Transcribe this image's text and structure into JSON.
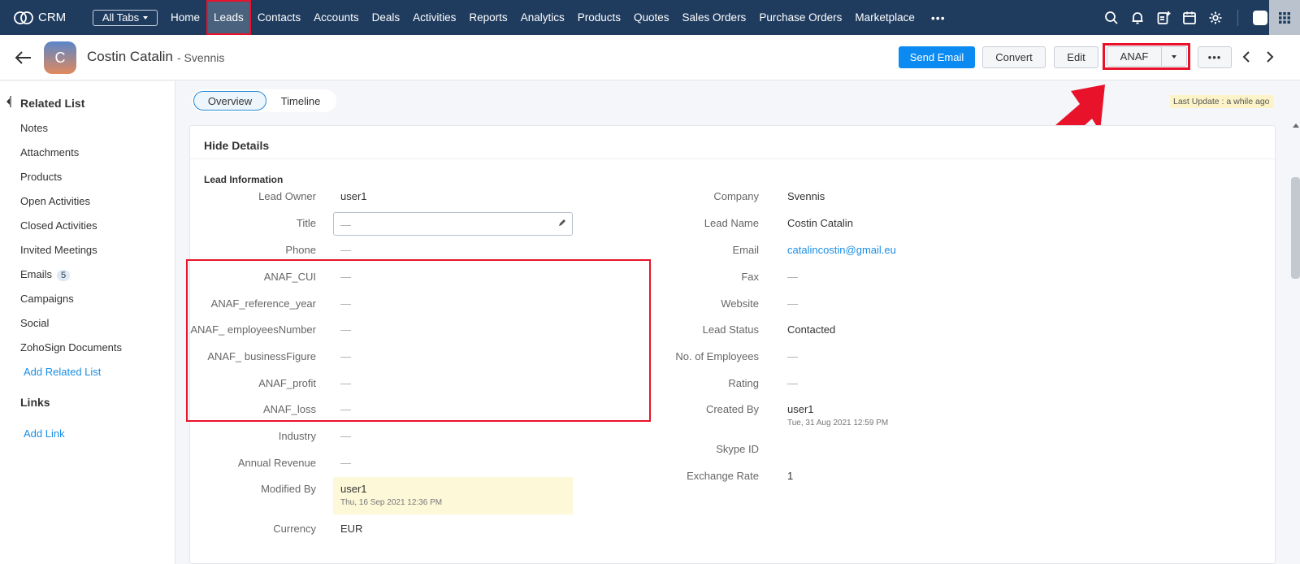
{
  "nav": {
    "brand": "CRM",
    "all_tabs": "All Tabs",
    "tabs": [
      "Home",
      "Leads",
      "Contacts",
      "Accounts",
      "Deals",
      "Activities",
      "Reports",
      "Analytics",
      "Products",
      "Quotes",
      "Sales Orders",
      "Purchase Orders",
      "Marketplace"
    ],
    "active_tab": "Leads",
    "more": "•••",
    "icons": [
      "search-icon",
      "bell-icon",
      "add-note-icon",
      "calendar-icon",
      "gear-icon",
      "user-chip",
      "apps-grid-icon"
    ]
  },
  "record": {
    "avatar_initial": "C",
    "name": "Costin Catalin",
    "subtitle": "- Svennis"
  },
  "actions": {
    "send_email": "Send Email",
    "convert": "Convert",
    "edit": "Edit",
    "anaf": "ANAF",
    "more": "•••"
  },
  "sidebar": {
    "title": "Related List",
    "items": [
      "Notes",
      "Attachments",
      "Products",
      "Open Activities",
      "Closed Activities",
      "Invited Meetings",
      "Emails",
      "Campaigns",
      "Social",
      "ZohoSign Documents"
    ],
    "emails_badge": "5",
    "add_related": "Add Related List",
    "links_title": "Links",
    "add_link": "Add Link"
  },
  "tabs": {
    "overview": "Overview",
    "timeline": "Timeline",
    "last_update": "Last Update : a while ago"
  },
  "details": {
    "hide_details": "Hide Details",
    "section": "Lead Information",
    "left": [
      {
        "label": "Lead Owner",
        "value": "user1"
      },
      {
        "label": "Title",
        "value": "—"
      },
      {
        "label": "Phone",
        "value": "—"
      },
      {
        "label": "ANAF_CUI",
        "value": "—"
      },
      {
        "label": "ANAF_reference_year",
        "value": "—"
      },
      {
        "label": "ANAF_ employeesNumber",
        "value": "—"
      },
      {
        "label": "ANAF_ businessFigure",
        "value": "—"
      },
      {
        "label": "ANAF_profit",
        "value": "—"
      },
      {
        "label": "ANAF_loss",
        "value": "—"
      },
      {
        "label": "Industry",
        "value": "—"
      },
      {
        "label": "Annual Revenue",
        "value": "—"
      },
      {
        "label": "Modified By",
        "value": "user1",
        "sub": "Thu, 16 Sep 2021 12:36 PM"
      },
      {
        "label": "Currency",
        "value": "EUR"
      }
    ],
    "right": [
      {
        "label": "Company",
        "value": "Svennis"
      },
      {
        "label": "Lead Name",
        "value": "Costin Catalin"
      },
      {
        "label": "Email",
        "value": "catalincostin@gmail.eu"
      },
      {
        "label": "Fax",
        "value": "—"
      },
      {
        "label": "Website",
        "value": "—"
      },
      {
        "label": "Lead Status",
        "value": "Contacted"
      },
      {
        "label": "No. of Employees",
        "value": "—"
      },
      {
        "label": "Rating",
        "value": "—"
      },
      {
        "label": "Created By",
        "value": "user1",
        "sub": "Tue, 31 Aug 2021 12:59 PM"
      },
      {
        "label": "Skype ID",
        "value": ""
      },
      {
        "label": "Exchange Rate",
        "value": "1"
      }
    ]
  },
  "colors": {
    "nav_bg": "#1f3c5f",
    "primary": "#0b8bf1",
    "highlight_red": "#e8132b",
    "link": "#1a8ee6"
  }
}
